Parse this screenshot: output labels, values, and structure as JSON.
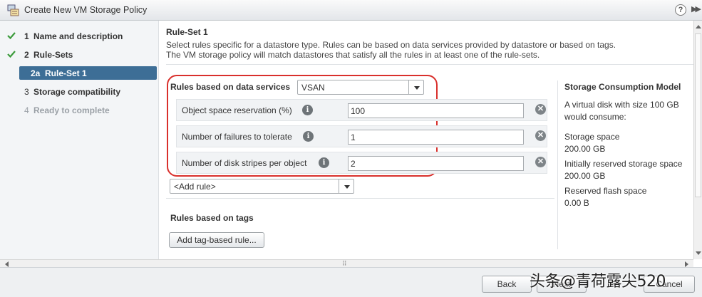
{
  "window": {
    "title": "Create New VM Storage Policy",
    "help": "?",
    "expand": "▶▶"
  },
  "nav": {
    "items": [
      {
        "num": "1",
        "label": "Name and description",
        "state": "done"
      },
      {
        "num": "2",
        "label": "Rule-Sets",
        "state": "done"
      },
      {
        "num": "2a",
        "label": "Rule-Set 1",
        "state": "active"
      },
      {
        "num": "3",
        "label": "Storage compatibility",
        "state": "plain"
      },
      {
        "num": "4",
        "label": "Ready to complete",
        "state": "disabled"
      }
    ]
  },
  "main": {
    "title": "Rule-Set 1",
    "desc_line1": "Select rules specific for a datastore type. Rules can be based on data services provided by datastore or based on tags.",
    "desc_line2": "The VM storage policy will match datastores that satisfy all the rules in at least one of the rule-sets.",
    "rules_label": "Rules based on data services",
    "datastore_type": "VSAN",
    "rules": [
      {
        "label": "Object space reservation (%)",
        "value": "100"
      },
      {
        "label": "Number of failures to tolerate",
        "value": "1"
      },
      {
        "label": "Number of disk stripes per object",
        "value": "2"
      }
    ],
    "add_rule": "<Add rule>",
    "tags_label": "Rules based on tags",
    "add_tag_rule": "Add tag-based rule..."
  },
  "side": {
    "title": "Storage Consumption Model",
    "intro": "A virtual disk with size 100 GB would consume:",
    "storage_label": "Storage space",
    "storage_value": "200.00 GB",
    "reserved_label": "Initially reserved storage space",
    "reserved_value": "200.00 GB",
    "flash_label": "Reserved flash space",
    "flash_value": "0.00 B"
  },
  "footer": {
    "back": "Back",
    "next": "Next",
    "cancel": "Cancel"
  },
  "watermark": "头条@青荷露尖520",
  "colors": {
    "accent": "#3d6e96",
    "highlight": "#d9302c",
    "check": "#3c9b3c"
  }
}
